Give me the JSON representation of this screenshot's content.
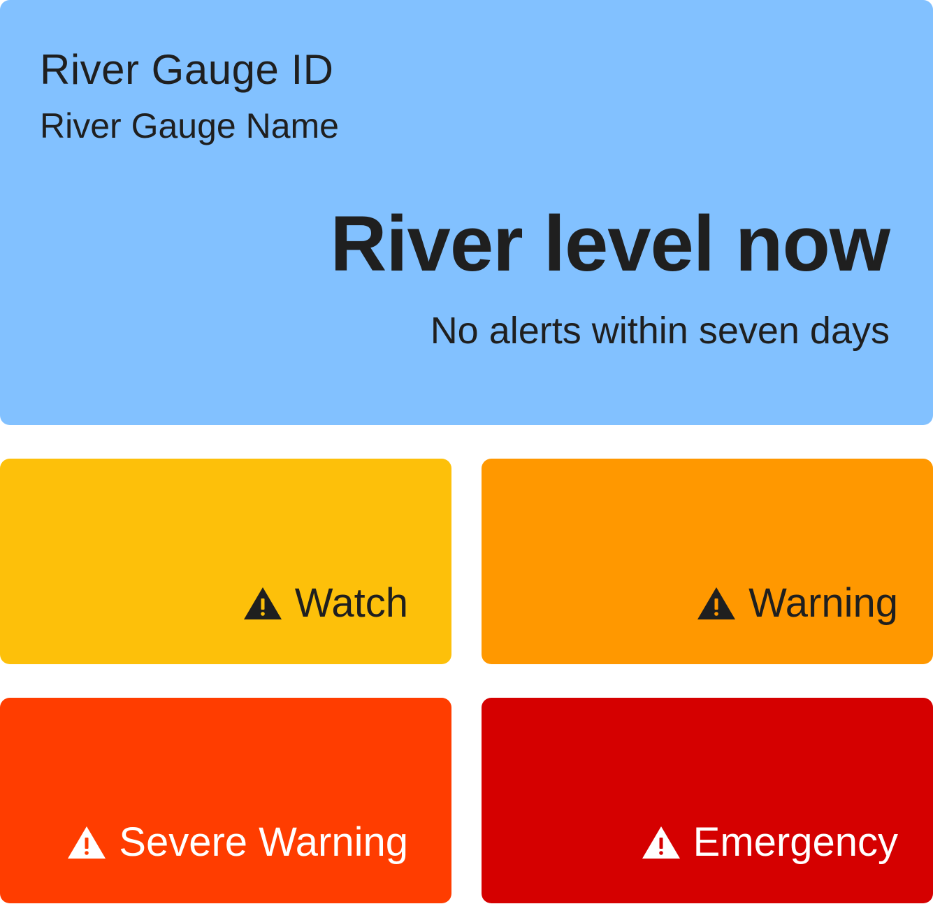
{
  "gauge": {
    "id_label": "River Gauge ID",
    "name_label": "River Gauge Name",
    "level_heading": "River level now",
    "alert_summary": "No alerts within seven days"
  },
  "tiles": [
    {
      "label": "Watch",
      "icon": "warning-triangle-icon",
      "bg": "#fdc00a",
      "fg": "#1f1f1f"
    },
    {
      "label": "Warning",
      "icon": "warning-triangle-icon",
      "bg": "#ff9800",
      "fg": "#1f1f1f"
    },
    {
      "label": "Severe Warning",
      "icon": "warning-triangle-icon",
      "bg": "#ff3d00",
      "fg": "#ffffff"
    },
    {
      "label": "Emergency",
      "icon": "warning-triangle-icon",
      "bg": "#d50000",
      "fg": "#ffffff"
    }
  ],
  "colors": {
    "main_card_bg": "#82c1ff",
    "text_dark": "#1f1f1f",
    "text_light": "#ffffff"
  }
}
